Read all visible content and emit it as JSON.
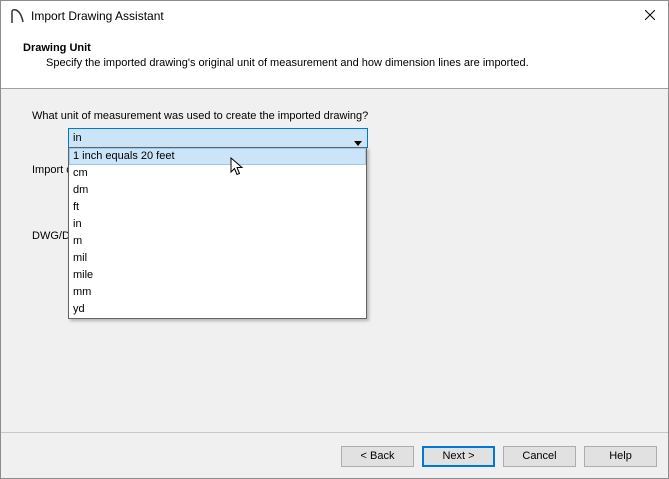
{
  "window": {
    "title": "Import Drawing Assistant",
    "close_icon": "close-icon",
    "app_icon": "app-arc-icon"
  },
  "header": {
    "title": "Drawing Unit",
    "subtitle": "Specify the imported drawing's original unit of measurement and how dimension lines are imported."
  },
  "main": {
    "question": "What unit of measurement was used to create the imported drawing?",
    "unit_select": {
      "value": "in",
      "options": [
        "1 inch equals 20 feet",
        "cm",
        "dm",
        "ft",
        "in",
        "m",
        "mil",
        "mile",
        "mm",
        "yd"
      ],
      "highlighted": "1 inch equals 20 feet"
    },
    "label_import_partial": "Import d",
    "label_dwg_partial": "DWG/D"
  },
  "buttons": {
    "back": "< Back",
    "next": "Next >",
    "cancel": "Cancel",
    "help": "Help"
  },
  "colors": {
    "accent": "#0078d7",
    "selection": "#cce4f7"
  }
}
